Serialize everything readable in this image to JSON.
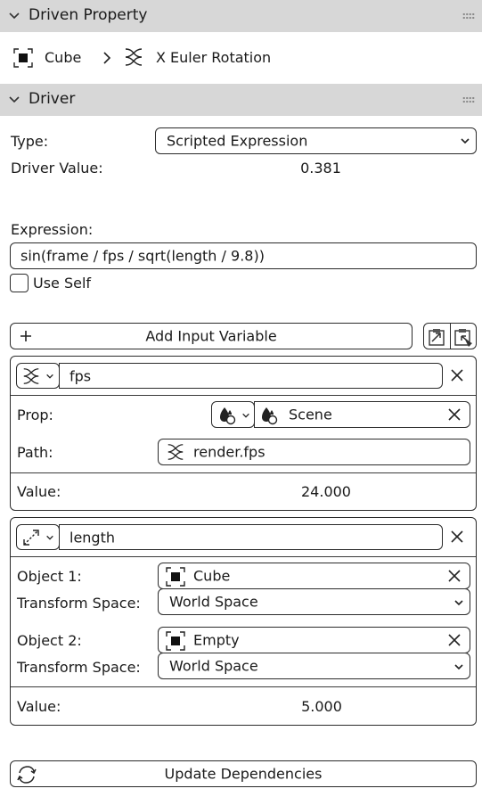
{
  "driven_property": {
    "header": "Driven Property",
    "object": "Cube",
    "property": "X Euler Rotation"
  },
  "driver": {
    "header": "Driver",
    "type_label": "Type:",
    "type_value": "Scripted Expression",
    "driver_value_label": "Driver Value:",
    "driver_value": "0.381",
    "expression_label": "Expression:",
    "expression": "sin(frame / fps / sqrt(length / 9.8))",
    "use_self_label": "Use Self",
    "use_self_checked": false,
    "add_variable_label": "Add Input Variable"
  },
  "variables": [
    {
      "name": "fps",
      "prop_label": "Prop:",
      "prop_value": "Scene",
      "path_label": "Path:",
      "path_value": "render.fps",
      "value_label": "Value:",
      "value": "24.000"
    },
    {
      "name": "length",
      "object1_label": "Object 1:",
      "object1_value": "Cube",
      "transform1_label": "Transform Space:",
      "transform1_value": "World Space",
      "object2_label": "Object 2:",
      "object2_value": "Empty",
      "transform2_label": "Transform Space:",
      "transform2_value": "World Space",
      "value_label": "Value:",
      "value": "5.000"
    }
  ],
  "update_dependencies_label": "Update Dependencies",
  "icons": {
    "object": "object-cube-icon",
    "driver": "driver-curve-icon",
    "distance": "distance-variable-icon",
    "scene": "scene-icon",
    "copy": "copy-driver-icon",
    "paste": "paste-driver-icon",
    "refresh": "refresh-icon"
  }
}
